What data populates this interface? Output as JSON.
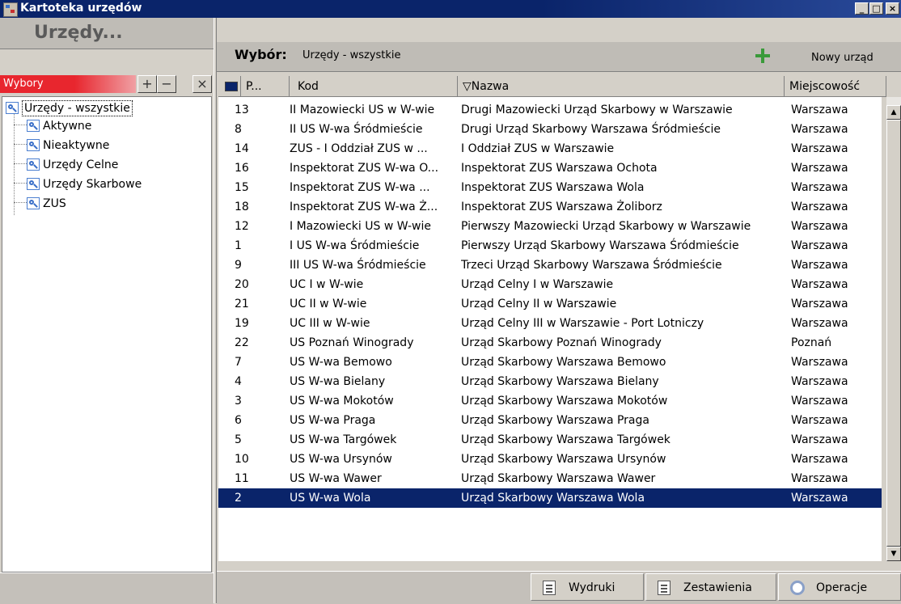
{
  "window": {
    "title": "Kartoteka urzędów",
    "min": "_",
    "max": "□",
    "close": "×"
  },
  "left": {
    "header": "Urzędy...",
    "filter_label": "Wybory",
    "add": "+",
    "remove": "−",
    "close": "×",
    "tree": [
      {
        "label": "Urzędy - wszystkie",
        "root": true
      },
      {
        "label": "Aktywne"
      },
      {
        "label": "Nieaktywne"
      },
      {
        "label": "Urzędy Celne"
      },
      {
        "label": "Urzędy Skarbowe"
      },
      {
        "label": "ZUS"
      }
    ]
  },
  "right": {
    "wybor_label": "Wybór:",
    "wybor_value": "Urzędy - wszystkie",
    "new_button": "Nowy urząd",
    "columns": {
      "p": "P...",
      "kod": "Kod",
      "nazwa": "▽Nazwa",
      "miejscowosc": "Miejscowość"
    },
    "rows": [
      {
        "p": "13",
        "kod": "II Mazowiecki US w W-wie",
        "nazwa": "Drugi Mazowiecki Urząd Skarbowy w Warszawie",
        "miejscowosc": "Warszawa"
      },
      {
        "p": "8",
        "kod": "II US W-wa Śródmieście",
        "nazwa": "Drugi Urząd Skarbowy Warszawa Śródmieście",
        "miejscowosc": "Warszawa"
      },
      {
        "p": "14",
        "kod": "ZUS - I Oddział ZUS w ...",
        "nazwa": "I Oddział ZUS w Warszawie",
        "miejscowosc": "Warszawa"
      },
      {
        "p": "16",
        "kod": "Inspektorat ZUS W-wa O...",
        "nazwa": "Inspektorat ZUS Warszawa Ochota",
        "miejscowosc": "Warszawa"
      },
      {
        "p": "15",
        "kod": "Inspektorat ZUS W-wa ...",
        "nazwa": "Inspektorat ZUS Warszawa Wola",
        "miejscowosc": "Warszawa"
      },
      {
        "p": "18",
        "kod": "Inspektorat ZUS W-wa Ż...",
        "nazwa": "Inspektorat ZUS Warszawa Żoliborz",
        "miejscowosc": "Warszawa"
      },
      {
        "p": "12",
        "kod": "I Mazowiecki US w W-wie",
        "nazwa": "Pierwszy Mazowiecki Urząd Skarbowy w Warszawie",
        "miejscowosc": "Warszawa"
      },
      {
        "p": "1",
        "kod": "I US W-wa Śródmieście",
        "nazwa": "Pierwszy Urząd Skarbowy Warszawa Śródmieście",
        "miejscowosc": "Warszawa"
      },
      {
        "p": "9",
        "kod": "III US W-wa Śródmieście",
        "nazwa": "Trzeci Urząd Skarbowy Warszawa Śródmieście",
        "miejscowosc": "Warszawa"
      },
      {
        "p": "20",
        "kod": "UC I w W-wie",
        "nazwa": "Urząd Celny I w Warszawie",
        "miejscowosc": "Warszawa"
      },
      {
        "p": "21",
        "kod": "UC II w W-wie",
        "nazwa": "Urząd Celny II w Warszawie",
        "miejscowosc": "Warszawa"
      },
      {
        "p": "19",
        "kod": "UC III w W-wie",
        "nazwa": "Urząd Celny III w Warszawie - Port Lotniczy",
        "miejscowosc": "Warszawa"
      },
      {
        "p": "22",
        "kod": "US Poznań Winogrady",
        "nazwa": "Urząd Skarbowy Poznań Winogrady",
        "miejscowosc": "Poznań"
      },
      {
        "p": "7",
        "kod": "US W-wa Bemowo",
        "nazwa": "Urząd Skarbowy Warszawa Bemowo",
        "miejscowosc": "Warszawa"
      },
      {
        "p": "4",
        "kod": "US W-wa Bielany",
        "nazwa": "Urząd Skarbowy Warszawa Bielany",
        "miejscowosc": "Warszawa"
      },
      {
        "p": "3",
        "kod": "US W-wa Mokotów",
        "nazwa": "Urząd Skarbowy Warszawa Mokotów",
        "miejscowosc": "Warszawa"
      },
      {
        "p": "6",
        "kod": "US W-wa Praga",
        "nazwa": "Urząd Skarbowy Warszawa Praga",
        "miejscowosc": "Warszawa"
      },
      {
        "p": "5",
        "kod": "US W-wa Targówek",
        "nazwa": "Urząd Skarbowy Warszawa Targówek",
        "miejscowosc": "Warszawa"
      },
      {
        "p": "10",
        "kod": "US W-wa Ursynów",
        "nazwa": "Urząd Skarbowy Warszawa Ursynów",
        "miejscowosc": "Warszawa"
      },
      {
        "p": "11",
        "kod": "US W-wa Wawer",
        "nazwa": "Urząd Skarbowy Warszawa Wawer",
        "miejscowosc": "Warszawa"
      },
      {
        "p": "2",
        "kod": "US W-wa Wola",
        "nazwa": "Urząd Skarbowy Warszawa Wola",
        "miejscowosc": "Warszawa",
        "selected": true
      }
    ]
  },
  "bottom": {
    "wydruki": "Wydruki",
    "zestawienia": "Zestawienia",
    "operacje": "Operacje"
  },
  "colors": {
    "selection": "#0a246a",
    "filter_red": "#e8262e",
    "titlebar": "#0a246a"
  }
}
